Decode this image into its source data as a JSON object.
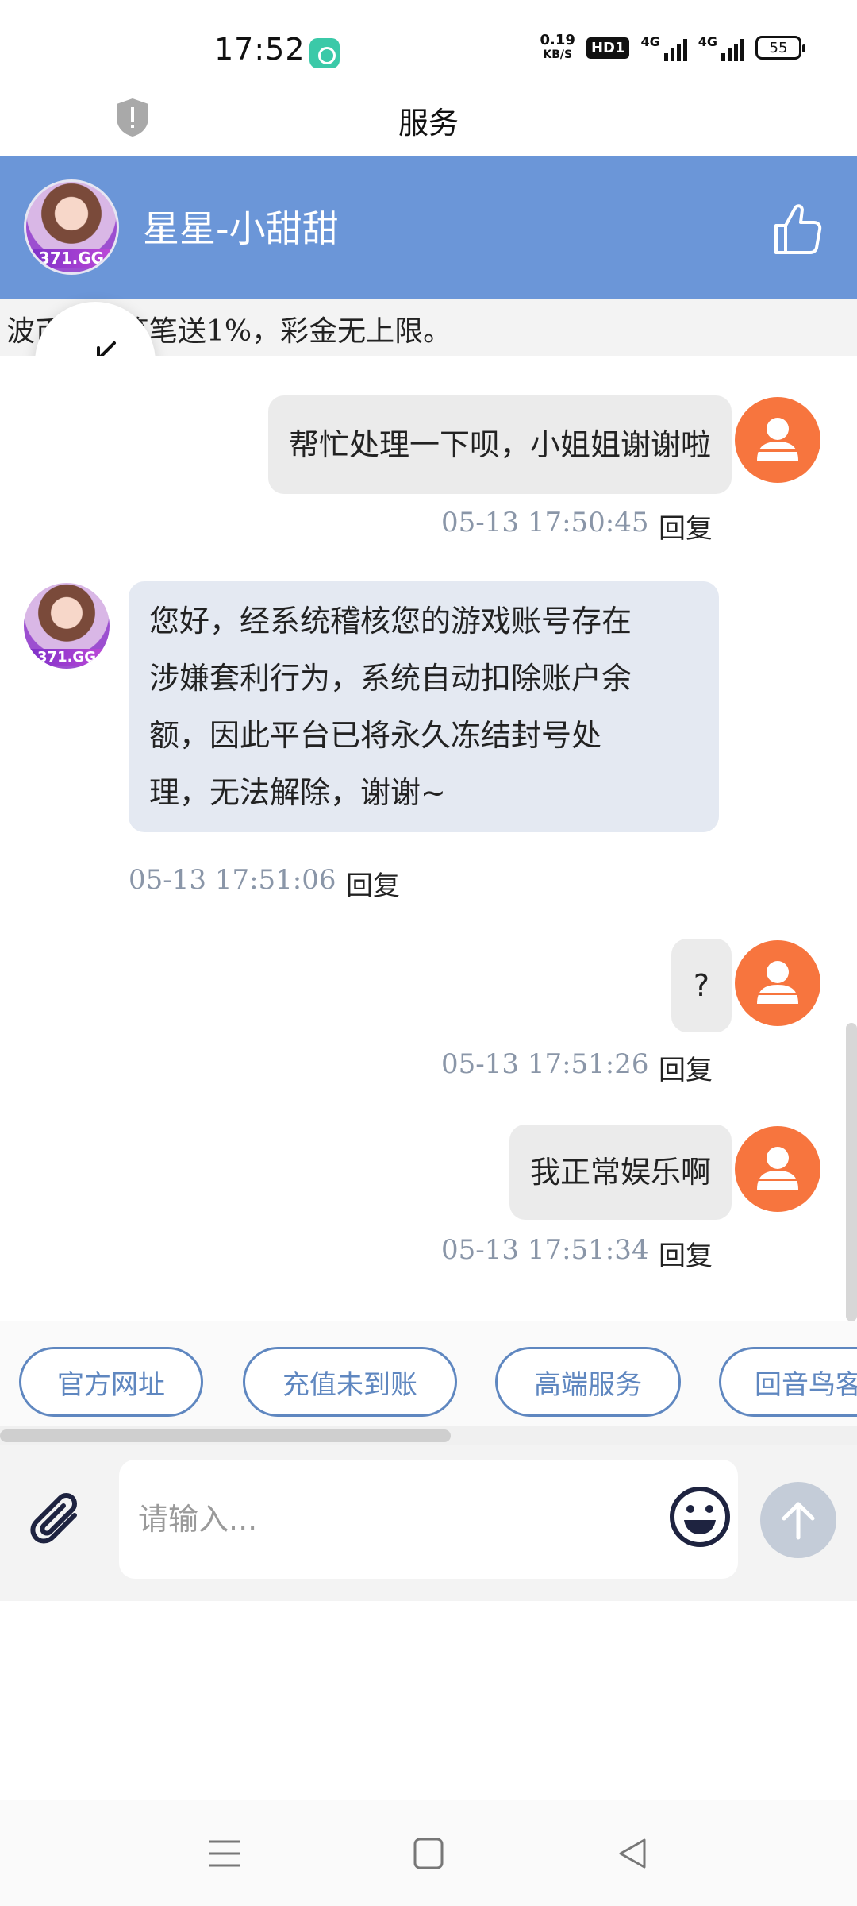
{
  "status_bar": {
    "time": "17:52",
    "net_speed_value": "0.19",
    "net_speed_unit": "KB/S",
    "hd_label": "HD1",
    "network_1": "4G",
    "network_2": "4G",
    "battery": "55"
  },
  "titlebar": {
    "title": "服务"
  },
  "header": {
    "agent_name": "星星-小甜甜",
    "avatar_label": "371.GG"
  },
  "marquee": {
    "text": "波币提现笔笔送1%，彩金无上限。"
  },
  "messages": [
    {
      "side": "user",
      "text": "帮忙处理一下呗，小姐姐谢谢啦",
      "time": "05-13 17:50:45",
      "reply": "回复"
    },
    {
      "side": "agent",
      "lines": [
        "您好，经系统稽核您的游戏账号存在",
        "涉嫌套利行为，系统自动扣除账户余",
        "额，因此平台已将永久冻结封号处",
        "理，无法解除，谢谢~"
      ],
      "time": "05-13 17:51:06",
      "reply": "回复",
      "avatar_label": "371.GG"
    },
    {
      "side": "user",
      "text": "?",
      "time": "05-13 17:51:26",
      "reply": "回复"
    },
    {
      "side": "user",
      "text": "我正常娱乐啊",
      "time": "05-13 17:51:34",
      "reply": "回复"
    }
  ],
  "quick_chips": [
    "官方网址",
    "充值未到账",
    "高端服务",
    "回音鸟客"
  ],
  "input": {
    "placeholder": "请输入..."
  },
  "colors": {
    "header": "#6b96d8",
    "user_avatar": "#f7753e",
    "chip": "#5f87c0"
  },
  "icons": [
    "shield-icon",
    "thumbs-up-icon",
    "collapse-icon",
    "user-icon",
    "paperclip-icon",
    "emoji-icon",
    "send-arrow-icon",
    "menu-icon",
    "home-icon",
    "back-icon"
  ]
}
